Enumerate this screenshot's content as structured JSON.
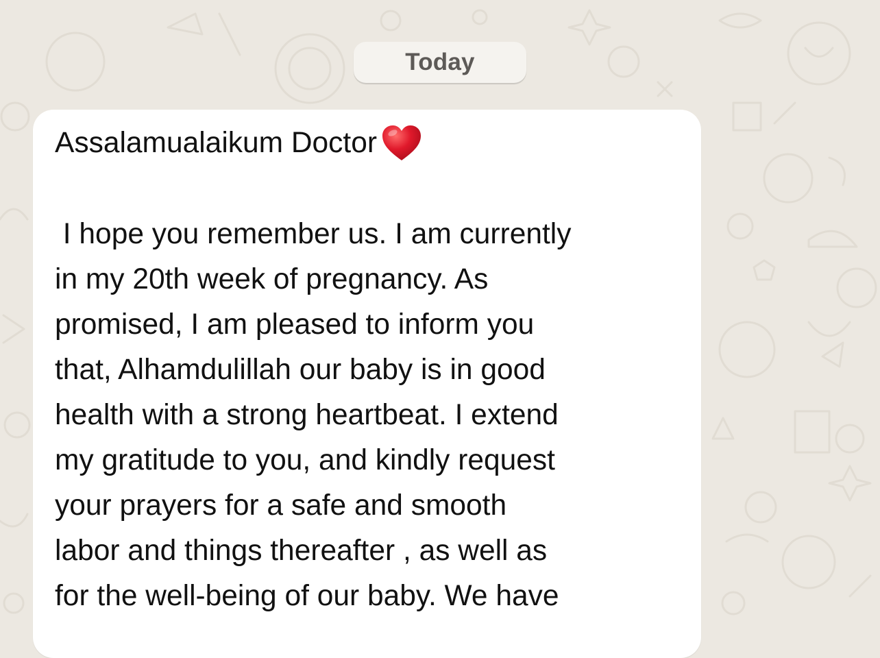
{
  "date_separator": {
    "label": "Today"
  },
  "message": {
    "greeting": "Assalamualaikum Doctor",
    "greeting_emoji": "red-heart-emoji",
    "body_lines": [
      " I hope you remember us. I am currently",
      "in my 20th week of pregnancy. As",
      "promised, I am pleased to inform you",
      "that, Alhamdulillah our baby is in good",
      "health with a strong heartbeat. I extend",
      "my gratitude to you, and kindly request",
      "your prayers for a safe and smooth",
      "labor and things thereafter , as well as",
      "for the well-being of our baby. We have"
    ]
  },
  "colors": {
    "wallpaper": "#ece8e1",
    "wallpaper_doodle": "#e3ded6",
    "bubble": "#ffffff",
    "date_chip": "#f5f3ef",
    "date_text": "#5d5a57",
    "message_text": "#111111",
    "heart": "#e0192b"
  }
}
